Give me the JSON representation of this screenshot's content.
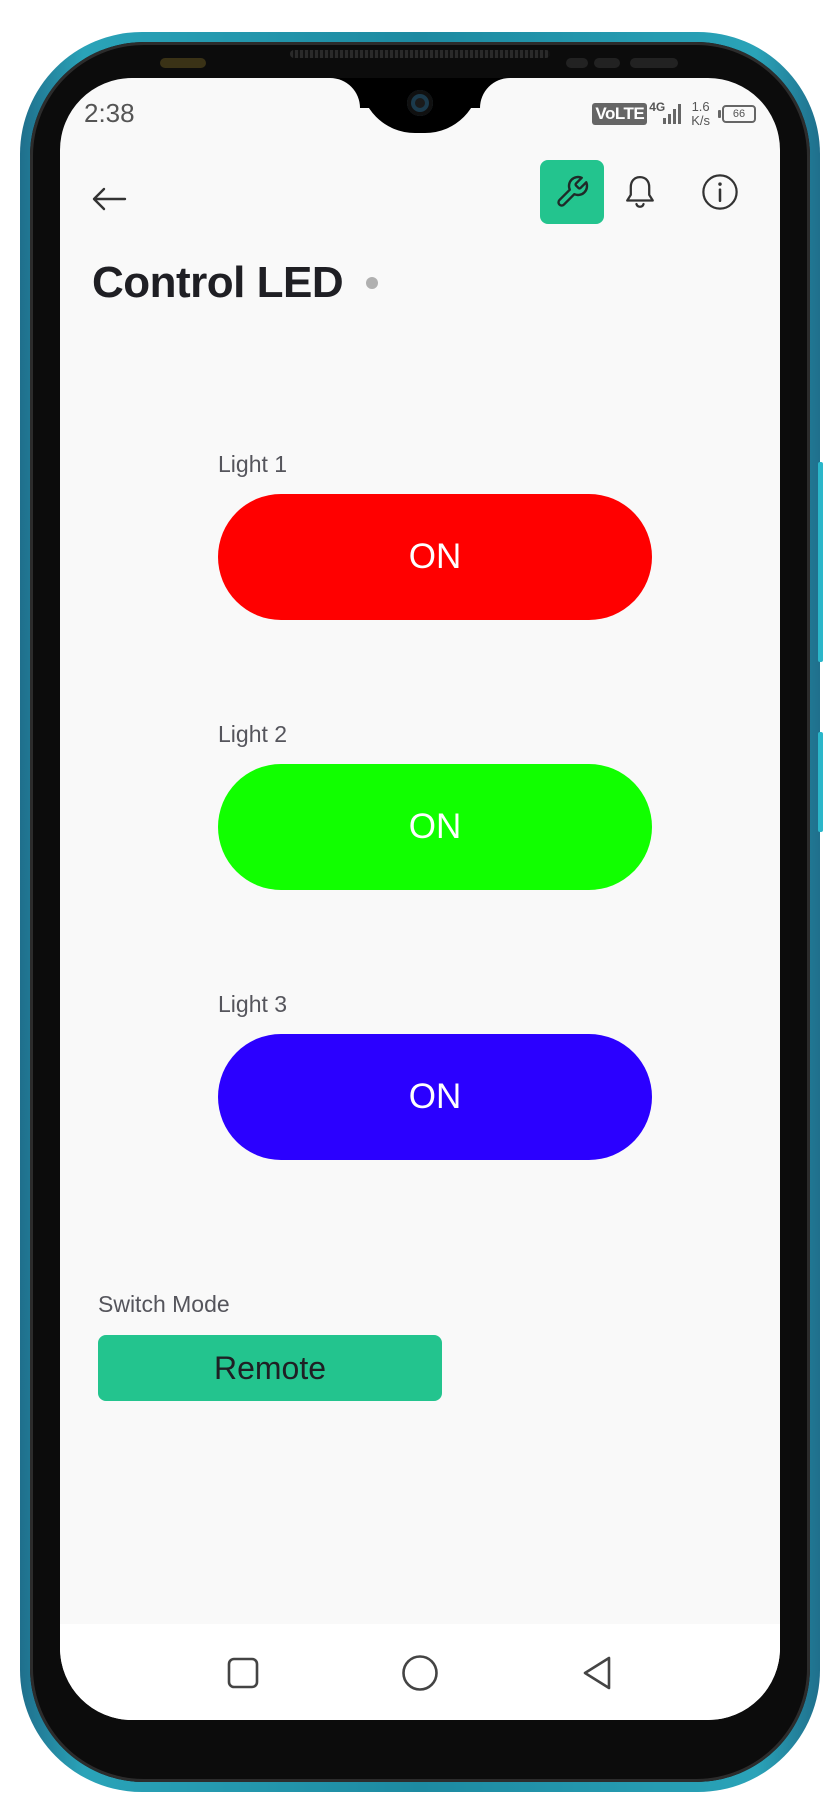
{
  "status_bar": {
    "time": "2:38",
    "volte": "VoLTE",
    "network_type": "4G",
    "speed_value": "1.6",
    "speed_unit": "K/s",
    "battery": "66"
  },
  "header": {
    "back_icon": "arrow-left-icon",
    "actions": [
      {
        "icon": "wrench-icon",
        "active": true
      },
      {
        "icon": "bell-icon",
        "active": false
      },
      {
        "icon": "info-icon",
        "active": false
      }
    ]
  },
  "page": {
    "title": "Control LED",
    "status_dot_color": "#b0b0b0"
  },
  "lights": [
    {
      "label": "Light 1",
      "button": "ON",
      "color": "#ff0000"
    },
    {
      "label": "Light 2",
      "button": "ON",
      "color": "#11ff00"
    },
    {
      "label": "Light 3",
      "button": "ON",
      "color": "#2b00ff"
    }
  ],
  "mode": {
    "label": "Switch Mode",
    "button": "Remote",
    "color": "#23c48e"
  },
  "nav_bar": {
    "icons": [
      "square-icon",
      "circle-icon",
      "triangle-back-icon"
    ]
  },
  "colors": {
    "accent": "#23c48e",
    "background": "#f9f9f9",
    "frame": "#1d8aa1"
  }
}
